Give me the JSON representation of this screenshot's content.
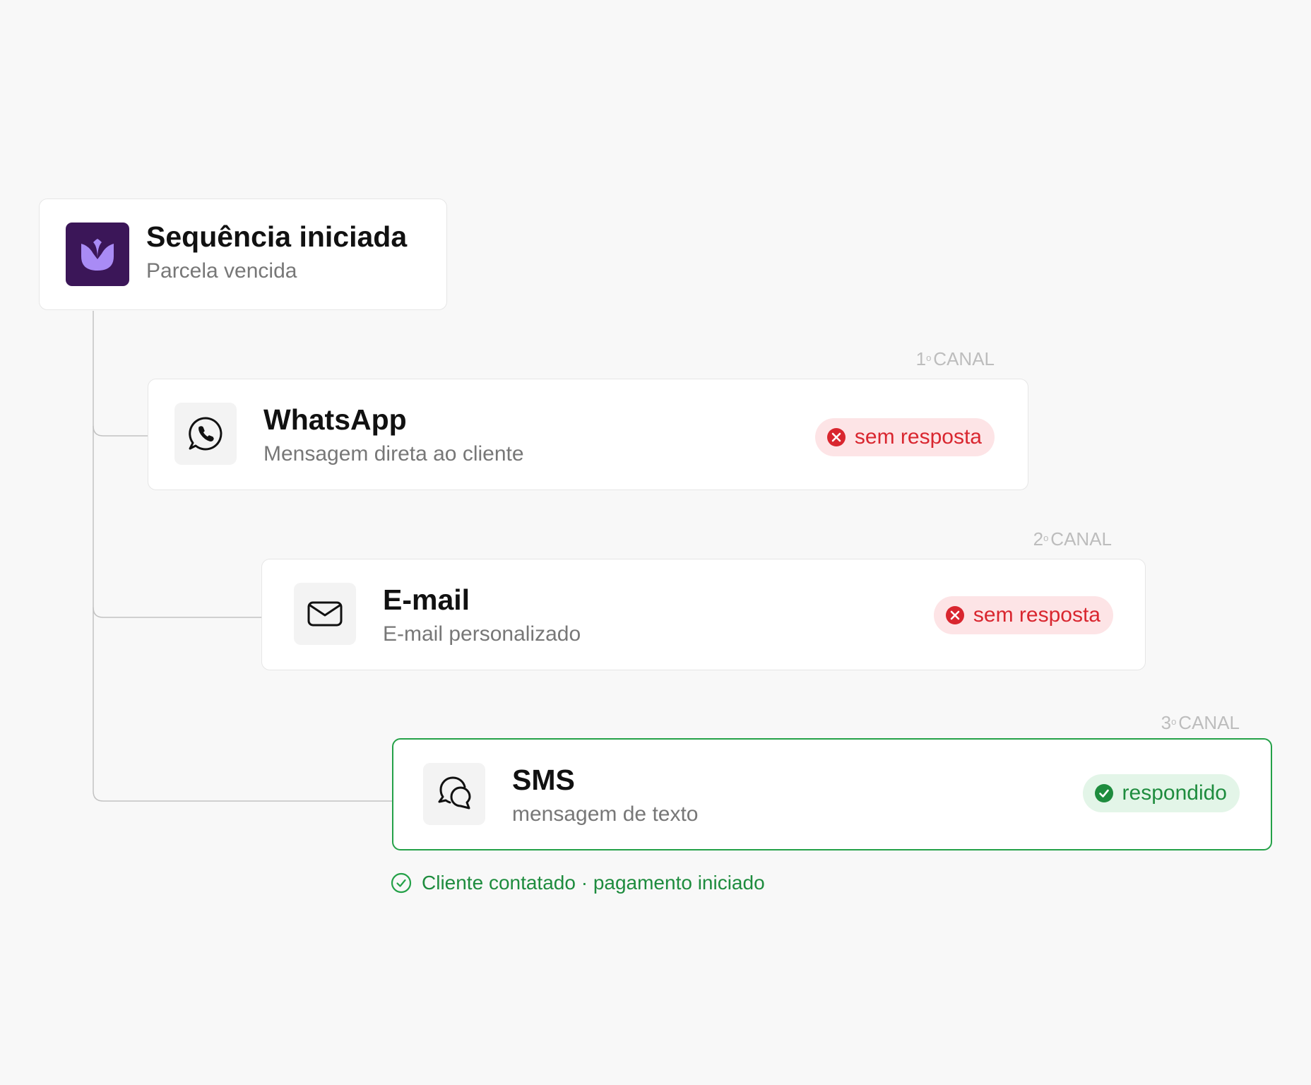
{
  "start": {
    "title": "Sequência iniciada",
    "subtitle": "Parcela vencida",
    "brand_color": "#3b1658",
    "brand_accent": "#a98bf5"
  },
  "channels": [
    {
      "ordinal": "1",
      "ordinal_mark": "o",
      "label_suffix": "CANAL",
      "title": "WhatsApp",
      "subtitle": "Mensagem direta ao cliente",
      "status": "sem resposta",
      "status_type": "fail",
      "icon": "whatsapp-icon"
    },
    {
      "ordinal": "2",
      "ordinal_mark": "o",
      "label_suffix": "CANAL",
      "title": "E-mail",
      "subtitle": "E-mail personalizado",
      "status": "sem resposta",
      "status_type": "fail",
      "icon": "envelope-icon"
    },
    {
      "ordinal": "3",
      "ordinal_mark": "o",
      "label_suffix": "CANAL",
      "title": "SMS",
      "subtitle": "mensagem de texto",
      "status": "respondido",
      "status_type": "ok",
      "icon": "chat-bubbles-icon"
    }
  ],
  "result": {
    "text": "Cliente contatado · pagamento iniciado",
    "icon": "check-circle-icon"
  },
  "colors": {
    "fail": "#d9262f",
    "fail_bg": "#fde4e6",
    "ok": "#1e8c3e",
    "ok_bg": "#e3f5e8",
    "success_border": "#24a148"
  }
}
